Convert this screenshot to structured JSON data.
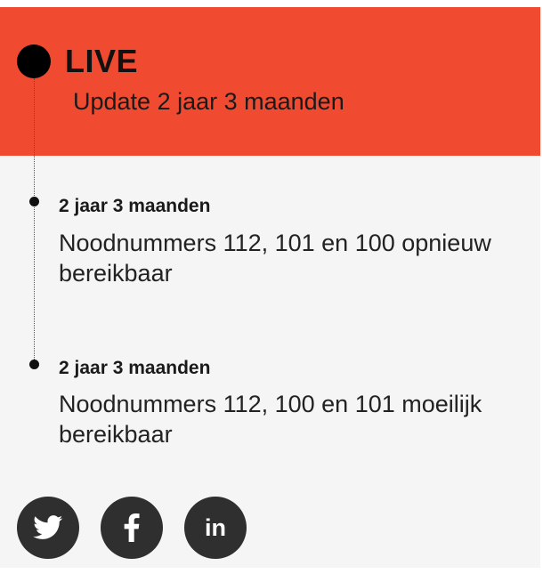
{
  "header": {
    "live_label": "LIVE",
    "update_text": "Update 2 jaar 3 maanden",
    "background_color": "#f04b30"
  },
  "entries": [
    {
      "time": "2 jaar 3 maanden",
      "title": "Noodnummers 112, 101 en 100 opnieuw bereikbaar"
    },
    {
      "time": "2 jaar 3 maanden",
      "title": "Noodnummers 112, 100 en 101 moeilijk bereikbaar"
    }
  ],
  "share": {
    "buttons": [
      {
        "icon": "twitter-icon"
      },
      {
        "icon": "facebook-icon"
      },
      {
        "icon": "linkedin-icon",
        "text": "in"
      }
    ],
    "button_color": "#2f2f2f"
  }
}
